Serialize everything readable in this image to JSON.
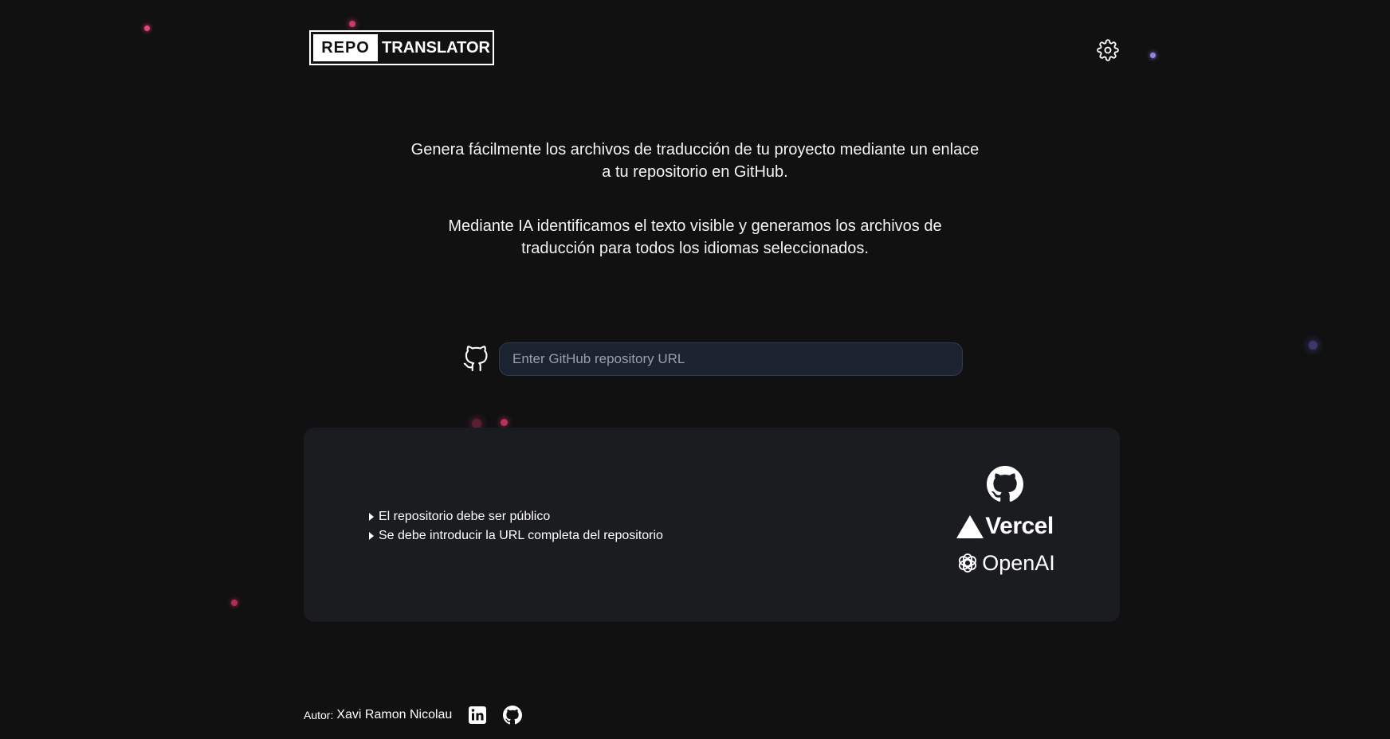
{
  "header": {
    "logo_left": "REPO",
    "logo_right": "TRANSLATOR",
    "settings_icon": "gear-icon"
  },
  "intro": {
    "paragraph1_line1": "Genera fácilmente los archivos de traducción de tu proyecto mediante un enlace",
    "paragraph1_line2": "a tu repositorio en GitHub.",
    "paragraph2_line1": "Mediante IA identificamos el texto visible y generamos los archivos de",
    "paragraph2_line2": "traducción para todos los idiomas seleccionados."
  },
  "repo_input": {
    "icon": "github-icon",
    "placeholder": "Enter GitHub repository URL",
    "value": ""
  },
  "info": {
    "tips": [
      "El repositorio debe ser público",
      "Se debe introducir la URL completa del repositorio"
    ],
    "brands": {
      "github_icon": "github-icon",
      "vercel": "Vercel",
      "openai": "OpenAI"
    }
  },
  "footer": {
    "label": "Autor:",
    "name": "Xavi Ramon Nicolau",
    "icons": [
      "linkedin-icon",
      "github-icon"
    ]
  },
  "colors": {
    "background": "#111112",
    "card": "#1b1c1f",
    "input_bg": "#1b2230",
    "text": "#ffffff"
  }
}
